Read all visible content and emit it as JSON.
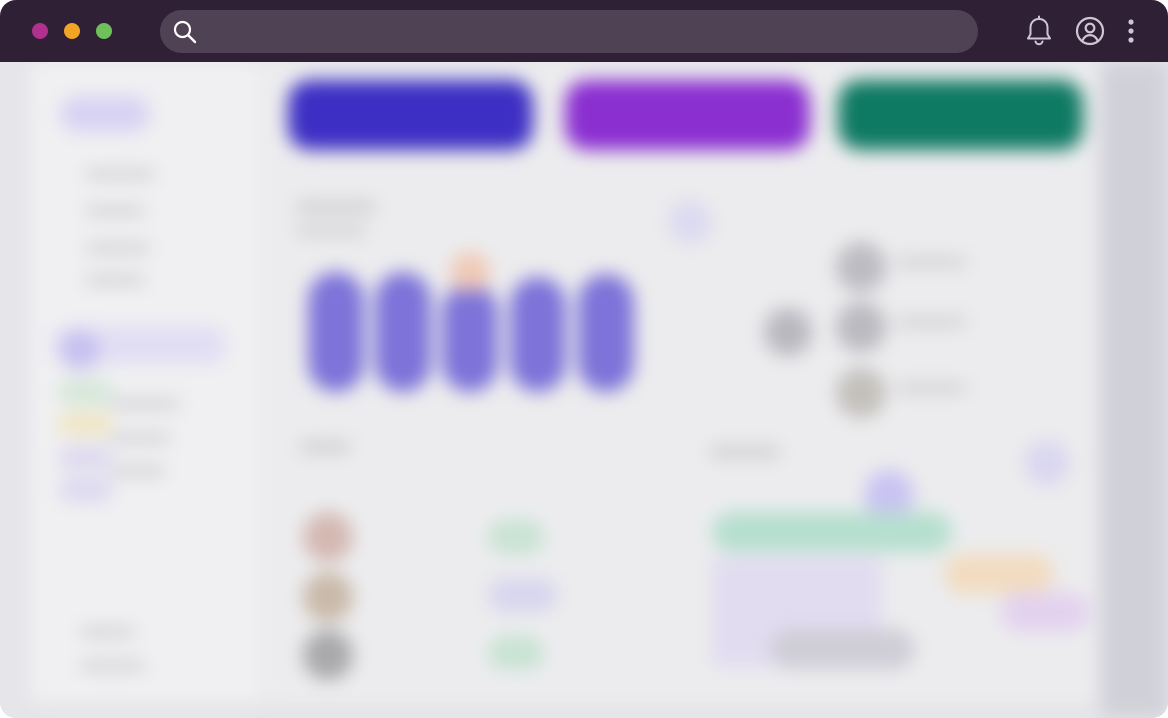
{
  "window": {
    "controls": [
      {
        "name": "close",
        "color": "#b0318d"
      },
      {
        "name": "minimize",
        "color": "#f2a524"
      },
      {
        "name": "maximize",
        "color": "#6fbf5a"
      }
    ]
  },
  "search": {
    "placeholder": "",
    "value": ""
  },
  "header_icons": [
    "bell-icon",
    "user-circle-icon",
    "more-vertical-icon"
  ],
  "colors": {
    "titlebar": "#2f2036",
    "search_bg": "#4f4254",
    "card_blue": "#3d2fc4",
    "card_purple": "#8b2fd1",
    "card_green": "#0f7a63",
    "bar": "#7d73d9"
  }
}
